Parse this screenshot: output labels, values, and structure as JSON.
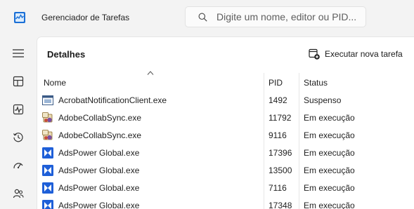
{
  "app": {
    "title": "Gerenciador de Tarefas",
    "icon": "task-manager-icon",
    "accent_color": "#1a6fd6"
  },
  "search": {
    "placeholder": "Digite um nome, editor ou PID...",
    "value": ""
  },
  "nav": {
    "items": [
      {
        "icon": "hamburger-menu-icon"
      },
      {
        "icon": "processes-icon"
      },
      {
        "icon": "performance-icon"
      },
      {
        "icon": "app-history-icon"
      },
      {
        "icon": "startup-apps-icon"
      },
      {
        "icon": "users-icon"
      }
    ]
  },
  "page": {
    "title": "Detalhes",
    "new_task_label": "Executar nova tarefa"
  },
  "table": {
    "columns": [
      "Nome",
      "PID",
      "Status"
    ],
    "sorted_by": "Nome",
    "rows": [
      {
        "name": "AcrobatNotificationClient.exe",
        "pid": "1492",
        "status": "Suspenso",
        "icon": "acrobat-app-icon"
      },
      {
        "name": "AdobeCollabSync.exe",
        "pid": "11792",
        "status": "Em execução",
        "icon": "adobe-collab-icon"
      },
      {
        "name": "AdobeCollabSync.exe",
        "pid": "9116",
        "status": "Em execução",
        "icon": "adobe-collab-icon"
      },
      {
        "name": "AdsPower Global.exe",
        "pid": "17396",
        "status": "Em execução",
        "icon": "adspower-icon"
      },
      {
        "name": "AdsPower Global.exe",
        "pid": "13500",
        "status": "Em execução",
        "icon": "adspower-icon"
      },
      {
        "name": "AdsPower Global.exe",
        "pid": "7116",
        "status": "Em execução",
        "icon": "adspower-icon"
      },
      {
        "name": "AdsPower Global.exe",
        "pid": "17348",
        "status": "Em execução",
        "icon": "adspower-icon"
      }
    ]
  }
}
